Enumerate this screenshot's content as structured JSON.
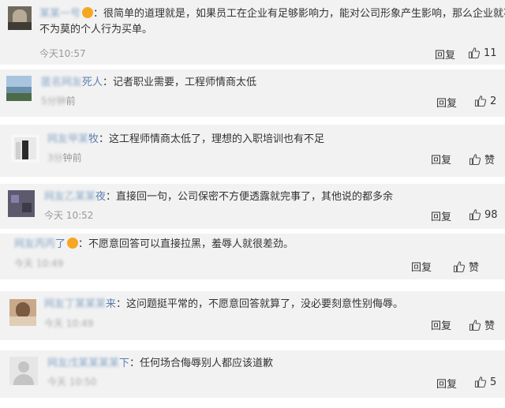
{
  "comments": [
    {
      "user_tail": "",
      "text": "很简单的道理就是，如果员工在企业有足够影响力，能对公司形象产生影响，那么企业就不得",
      "text2": "不为莫的个人行为买单。",
      "time": "今天10:57",
      "reply": "回复",
      "likes": "11"
    },
    {
      "user_tail": "死人",
      "text": "记者职业需要，工程师情商太低",
      "time_tail": "前",
      "reply": "回复",
      "likes": "2"
    },
    {
      "user_tail": "牧",
      "text": "这工程师情商太低了，理想的入职培训也有不足",
      "time_tail": "钟前",
      "reply": "回复",
      "likes": "赞"
    },
    {
      "user_tail": "夜",
      "text": "直接回一句，公司保密不方便透露就完事了，其他说的都多余",
      "time": "今天 10:52",
      "reply": "回复",
      "likes": "98"
    },
    {
      "user_tail": "了",
      "text": "不愿意回答可以直接拉黑，羞辱人就很差劲。",
      "reply": "回复",
      "likes": "赞"
    },
    {
      "user_tail": "来",
      "text": "这问题挺平常的，不愿意回答就算了，没必要刻意性别侮辱。",
      "reply": "回复",
      "likes": "赞"
    },
    {
      "user_tail": "下",
      "text": "任何场合侮辱别人都应该道歉",
      "time": "今天 10:50",
      "reply": "回复",
      "likes": "5"
    }
  ],
  "colors": {
    "card_bg": "#f2f2f2",
    "username": "#5b7fb0",
    "time": "#999999",
    "text": "#333333"
  },
  "icons": {
    "like": "thumbs-up-icon",
    "badge": "verified-badge-icon"
  }
}
